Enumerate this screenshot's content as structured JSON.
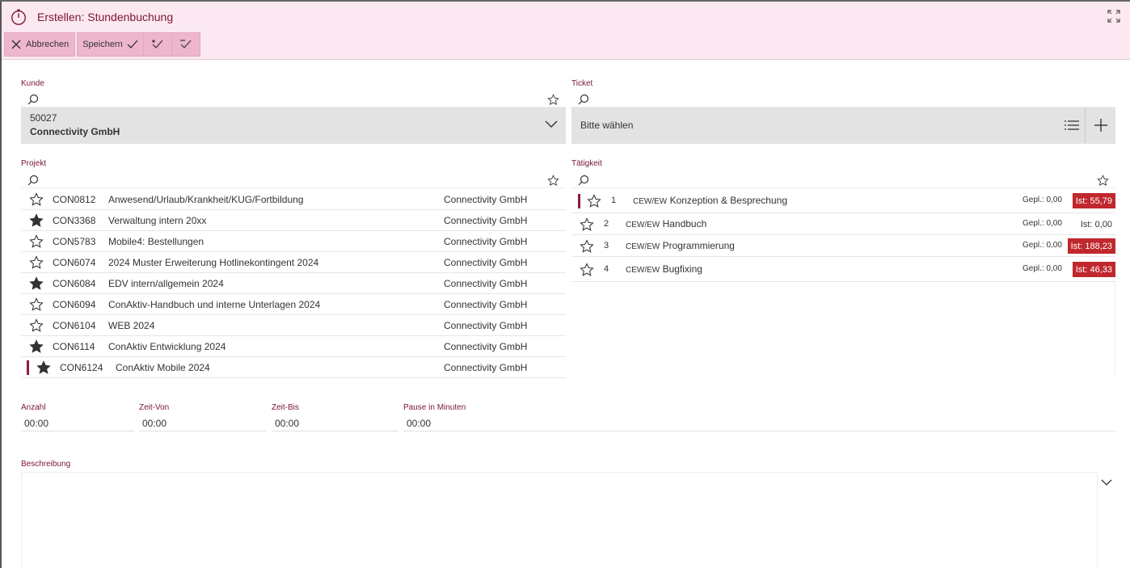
{
  "header": {
    "title": "Erstellen: Stundenbuchung",
    "toolbar": {
      "cancel_label": "Abbrechen",
      "save_label": "Speichern"
    }
  },
  "kunde": {
    "label": "Kunde",
    "number": "50027",
    "name": "Connectivity GmbH"
  },
  "ticket": {
    "label": "Ticket",
    "placeholder": "Bitte wählen"
  },
  "projekt": {
    "label": "Projekt",
    "rows": [
      {
        "code": "CON0812",
        "name": "Anwesend/Urlaub/Krankheit/KUG/Fortbildung",
        "customer": "Connectivity GmbH",
        "fav": false,
        "selected": false
      },
      {
        "code": "CON3368",
        "name": "Verwaltung intern 20xx",
        "customer": "Connectivity GmbH",
        "fav": true,
        "selected": false
      },
      {
        "code": "CON5783",
        "name": "Mobile4: Bestellungen",
        "customer": "Connectivity GmbH",
        "fav": false,
        "selected": false
      },
      {
        "code": "CON6074",
        "name": "2024 Muster Erweiterung Hotlinekontingent 2024",
        "customer": "Connectivity GmbH",
        "fav": false,
        "selected": false
      },
      {
        "code": "CON6084",
        "name": "EDV intern/allgemein 2024",
        "customer": "Connectivity GmbH",
        "fav": true,
        "selected": false
      },
      {
        "code": "CON6094",
        "name": "ConAktiv-Handbuch und interne Unterlagen 2024",
        "customer": "Connectivity GmbH",
        "fav": false,
        "selected": false
      },
      {
        "code": "CON6104",
        "name": "WEB 2024",
        "customer": "Connectivity GmbH",
        "fav": false,
        "selected": false
      },
      {
        "code": "CON6114",
        "name": "ConAktiv Entwicklung 2024",
        "customer": "Connectivity GmbH",
        "fav": true,
        "selected": false
      },
      {
        "code": "CON6124",
        "name": "ConAktiv Mobile 2024",
        "customer": "Connectivity GmbH",
        "fav": true,
        "selected": true
      }
    ]
  },
  "taetigkeit": {
    "label": "Tätigkeit",
    "rows": [
      {
        "num": "1",
        "prefix": "CEW/EW",
        "name": "Konzeption & Besprechung",
        "gepl": "Gepl.: 0,00",
        "ist": "Ist: 55,79",
        "ist_red": true,
        "selected": true
      },
      {
        "num": "2",
        "prefix": "CEW/EW",
        "name": "Handbuch",
        "gepl": "Gepl.: 0,00",
        "ist": "Ist: 0,00",
        "ist_red": false,
        "selected": false
      },
      {
        "num": "3",
        "prefix": "CEW/EW",
        "name": "Programmierung",
        "gepl": "Gepl.: 0,00",
        "ist": "Ist: 188,23",
        "ist_red": true,
        "selected": false
      },
      {
        "num": "4",
        "prefix": "CEW/EW",
        "name": "Bugfixing",
        "gepl": "Gepl.: 0,00",
        "ist": "Ist: 46,33",
        "ist_red": true,
        "selected": false
      }
    ]
  },
  "time": {
    "anzahl_label": "Anzahl",
    "anzahl": "00:00",
    "von_label": "Zeit-Von",
    "von": "00:00",
    "bis_label": "Zeit-Bis",
    "bis": "00:00",
    "pause_label": "Pause in Minuten",
    "pause": "00:00"
  },
  "beschreibung": {
    "label": "Beschreibung"
  },
  "colors": {
    "accent": "#8a1c3d",
    "header_bg": "#fbe8f1",
    "toolbar_btn": "#eeb6cc",
    "ist_red": "#c0282e"
  }
}
